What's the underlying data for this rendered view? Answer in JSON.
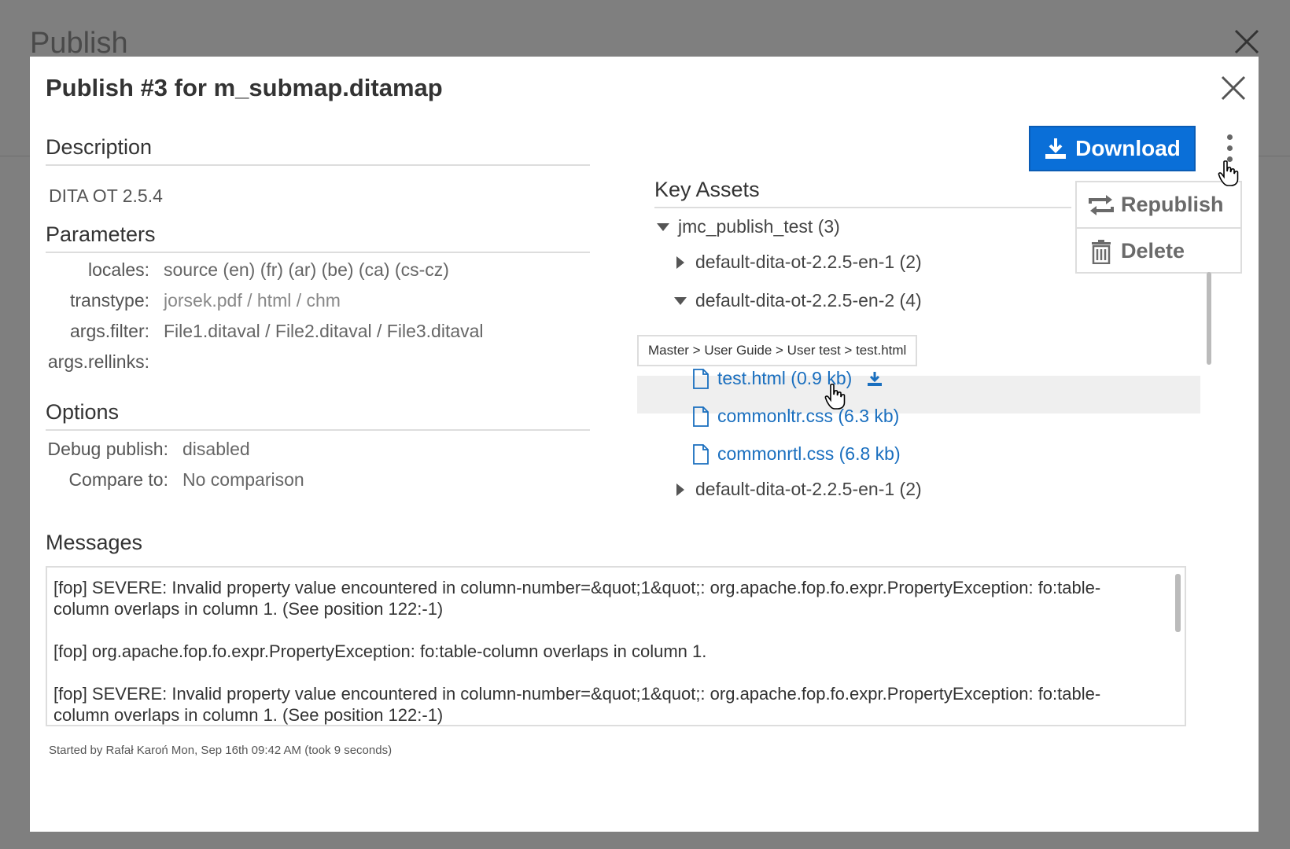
{
  "background": {
    "title": "Publish"
  },
  "modal": {
    "title": "Publish #3 for m_submap.ditamap",
    "description": {
      "heading": "Description",
      "value": "DITA OT 2.5.4"
    },
    "parameters": {
      "heading": "Parameters",
      "rows": [
        {
          "key": "locales:",
          "value": "source (en) (fr) (ar) (be) (ca) (cs-cz)"
        },
        {
          "key": "transtype:",
          "value": "jorsek.pdf / html / chm"
        },
        {
          "key": "args.filter:",
          "value": "File1.ditaval / File2.ditaval / File3.ditaval"
        },
        {
          "key": "args.rellinks:",
          "value": ""
        }
      ]
    },
    "options": {
      "heading": "Options",
      "rows": [
        {
          "key": "Debug publish:",
          "value": "disabled"
        },
        {
          "key": "Compare to:",
          "value": "No comparison"
        }
      ]
    },
    "actions": {
      "download_label": "Download",
      "menu": [
        {
          "label": "Republish",
          "icon": "republish-icon"
        },
        {
          "label": "Delete",
          "icon": "trash-icon"
        }
      ]
    },
    "key_assets": {
      "heading": "Key Assets",
      "tree": [
        {
          "label": "jmc_publish_test (3)",
          "expanded": true
        },
        {
          "label": "default-dita-ot-2.2.5-en-1 (2)",
          "expanded": false
        },
        {
          "label": "default-dita-ot-2.2.5-en-2 (4)",
          "expanded": true
        },
        {
          "label": "default-dita-ot-2.2.5-en-1 (2)",
          "expanded": false
        }
      ],
      "files": [
        {
          "label": "test.html (0.9 kb)"
        },
        {
          "label": "commonltr.css (6.3 kb)"
        },
        {
          "label": "commonrtl.css (6.8 kb)"
        }
      ],
      "tooltip": "Master > User Guide > User test > test.html"
    },
    "messages": {
      "heading": "Messages",
      "lines": [
        "[fop] SEVERE: Invalid property value encountered in column-number=&quot;1&quot;: org.apache.fop.fo.expr.PropertyException: fo:table-column overlaps in column 1. (See position 122:-1)",
        "[fop] org.apache.fop.fo.expr.PropertyException: fo:table-column overlaps in column 1.",
        "[fop] SEVERE: Invalid property value encountered in column-number=&quot;1&quot;: org.apache.fop.fo.expr.PropertyException: fo:table-column overlaps in column 1. (See position 122:-1)"
      ]
    },
    "footer": "Started by Rafał Karoń Mon, Sep 16th 09:42 AM (took 9 seconds)"
  },
  "colors": {
    "primary": "#0a6fd8",
    "link": "#1a6fbf",
    "overlay": "#7f7f7f"
  }
}
